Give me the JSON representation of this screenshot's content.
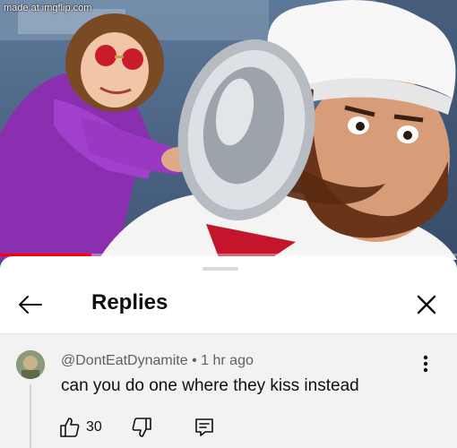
{
  "watermark": "made at imgflip.com",
  "player": {
    "progress_fraction": 0.2
  },
  "header": {
    "title": "Replies",
    "back_icon": "arrow-left-icon",
    "close_icon": "close-icon"
  },
  "comment": {
    "author": "@DontEatDynamite",
    "separator": "•",
    "time": "1 hr ago",
    "text": "can you do one where they kiss instead",
    "likes": "30",
    "icons": {
      "like": "thumbs-up-icon",
      "dislike": "thumbs-down-icon",
      "reply": "comment-icon",
      "more": "more-vertical-icon"
    }
  },
  "colors": {
    "progress": "#ff0000",
    "comment_bg": "#f2f2f2",
    "sheet_bg": "#ffffff"
  }
}
